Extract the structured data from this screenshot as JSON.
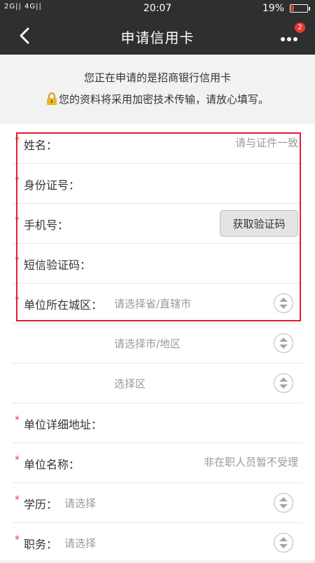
{
  "status_bar": {
    "signal": "2G|| 4G||",
    "time": "20:07",
    "battery": "19%",
    "battery_level": 0.19,
    "battery_color": "#e53935"
  },
  "nav": {
    "title": "申请信用卡",
    "back_icon": "chevron-left-icon",
    "more_icon": "more-dots-icon",
    "badge_count": "2"
  },
  "notice": {
    "line1": "您正在申请的是招商银行信用卡",
    "line2": "您的资料将采用加密技术传输，请放心填写。",
    "icon": "lock-icon"
  },
  "form": {
    "required_mark": "*",
    "name": {
      "label": "姓名：",
      "placeholder": "请与证件一致"
    },
    "id_number": {
      "label": "身份证号：",
      "placeholder": ""
    },
    "phone": {
      "label": "手机号：",
      "placeholder": "",
      "button": "获取验证码"
    },
    "sms_code": {
      "label": "短信验证码：",
      "placeholder": ""
    },
    "work_city": {
      "label": "单位所在城区：",
      "province_placeholder": "请选择省/直辖市",
      "city_placeholder": "请选择市/地区",
      "district_placeholder": "选择区"
    },
    "work_address": {
      "label": "单位详细地址：",
      "placeholder": ""
    },
    "company_name": {
      "label": "单位名称：",
      "placeholder": "非在职人员暂不受理"
    },
    "education": {
      "label": "学历：",
      "placeholder": "请选择"
    },
    "position": {
      "label": "职务：",
      "placeholder": "请选择"
    }
  },
  "colors": {
    "header_bg": "#2f2f2f",
    "required": "#e53935",
    "highlight_border": "#e01e2e"
  }
}
